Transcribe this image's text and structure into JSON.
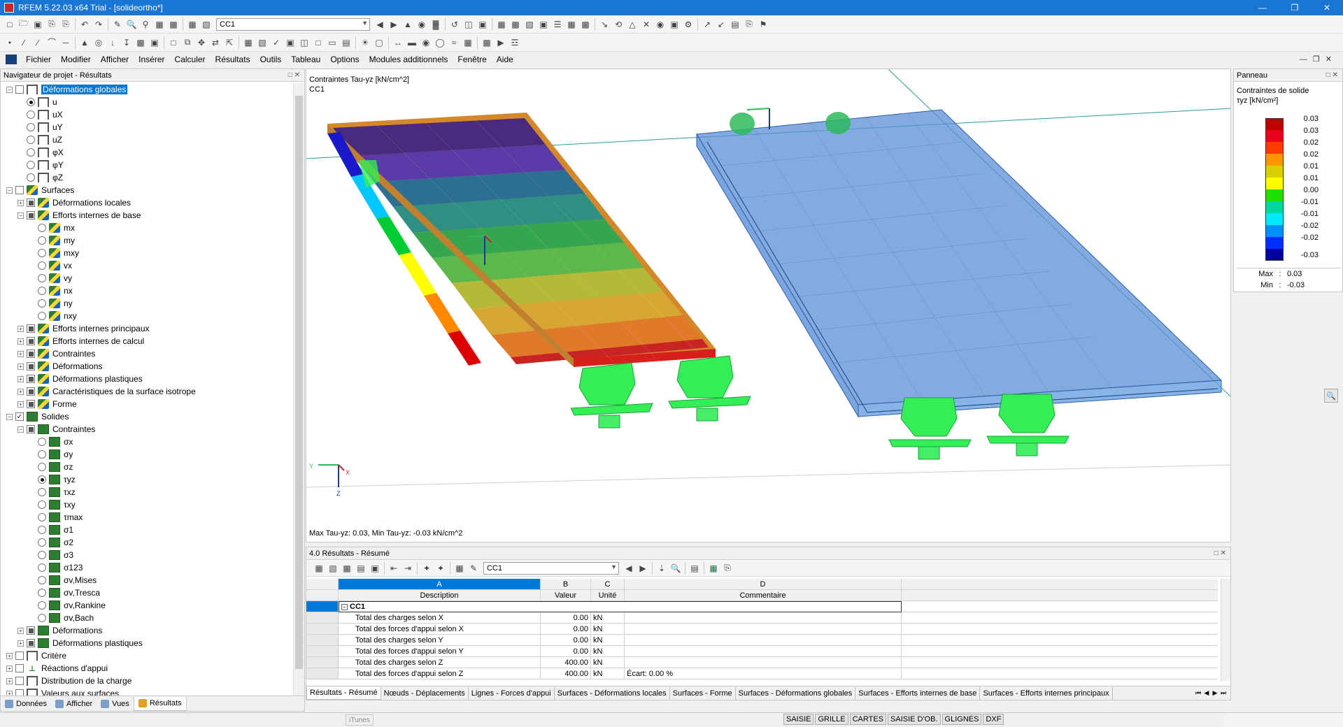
{
  "window": {
    "title": "RFEM 5.22.03 x64 Trial - [solideortho*]"
  },
  "toolbar": {
    "load_case": "CC1"
  },
  "menu": [
    "Fichier",
    "Modifier",
    "Afficher",
    "Insérer",
    "Calculer",
    "Résultats",
    "Outils",
    "Tableau",
    "Options",
    "Modules additionnels",
    "Fenêtre",
    "Aide"
  ],
  "navigator": {
    "title": "Navigateur de projet - Résultats",
    "rows": [
      {
        "d": 0,
        "exp": "-",
        "cb": "empty",
        "icon": "frame",
        "label": "Déformations globales",
        "hl": true
      },
      {
        "d": 1,
        "rb": "sel",
        "icon": "frame",
        "label": "u"
      },
      {
        "d": 1,
        "rb": "",
        "icon": "frame",
        "label": "uX"
      },
      {
        "d": 1,
        "rb": "",
        "icon": "frame",
        "label": "uY"
      },
      {
        "d": 1,
        "rb": "",
        "icon": "frame",
        "label": "uZ"
      },
      {
        "d": 1,
        "rb": "",
        "icon": "frame",
        "label": "φX"
      },
      {
        "d": 1,
        "rb": "",
        "icon": "frame",
        "label": "φY"
      },
      {
        "d": 1,
        "rb": "",
        "icon": "frame",
        "label": "φZ"
      },
      {
        "d": 0,
        "exp": "-",
        "cb": "empty",
        "icon": "surf",
        "label": "Surfaces"
      },
      {
        "d": 1,
        "exp": "+",
        "cb": "partial",
        "icon": "surf",
        "label": "Déformations locales"
      },
      {
        "d": 1,
        "exp": "-",
        "cb": "partial",
        "icon": "surf",
        "label": "Efforts internes de base"
      },
      {
        "d": 2,
        "rb": "",
        "icon": "surf",
        "label": "mx"
      },
      {
        "d": 2,
        "rb": "",
        "icon": "surf",
        "label": "my"
      },
      {
        "d": 2,
        "rb": "",
        "icon": "surf",
        "label": "mxy"
      },
      {
        "d": 2,
        "rb": "",
        "icon": "surf",
        "label": "vx"
      },
      {
        "d": 2,
        "rb": "",
        "icon": "surf",
        "label": "vy"
      },
      {
        "d": 2,
        "rb": "",
        "icon": "surf",
        "label": "nx"
      },
      {
        "d": 2,
        "rb": "",
        "icon": "surf",
        "label": "ny"
      },
      {
        "d": 2,
        "rb": "",
        "icon": "surf",
        "label": "nxy"
      },
      {
        "d": 1,
        "exp": "+",
        "cb": "partial",
        "icon": "surf",
        "label": "Efforts internes principaux"
      },
      {
        "d": 1,
        "exp": "+",
        "cb": "partial",
        "icon": "surf",
        "label": "Efforts internes de calcul"
      },
      {
        "d": 1,
        "exp": "+",
        "cb": "partial",
        "icon": "surf",
        "label": "Contraintes"
      },
      {
        "d": 1,
        "exp": "+",
        "cb": "partial",
        "icon": "surf",
        "label": "Déformations"
      },
      {
        "d": 1,
        "exp": "+",
        "cb": "partial",
        "icon": "surf",
        "label": "Déformations plastiques"
      },
      {
        "d": 1,
        "exp": "+",
        "cb": "partial",
        "icon": "surf",
        "label": "Caractéristiques de la surface isotrope"
      },
      {
        "d": 1,
        "exp": "+",
        "cb": "partial",
        "icon": "surf",
        "label": "Forme"
      },
      {
        "d": 0,
        "exp": "-",
        "cb": "checked",
        "icon": "solid",
        "label": "Solides"
      },
      {
        "d": 1,
        "exp": "-",
        "cb": "partial",
        "icon": "solid",
        "label": "Contraintes"
      },
      {
        "d": 2,
        "rb": "",
        "icon": "solid",
        "label": "σx"
      },
      {
        "d": 2,
        "rb": "",
        "icon": "solid",
        "label": "σy"
      },
      {
        "d": 2,
        "rb": "",
        "icon": "solid",
        "label": "σz"
      },
      {
        "d": 2,
        "rb": "sel",
        "icon": "solid",
        "label": "τyz"
      },
      {
        "d": 2,
        "rb": "",
        "icon": "solid",
        "label": "τxz"
      },
      {
        "d": 2,
        "rb": "",
        "icon": "solid",
        "label": "τxy"
      },
      {
        "d": 2,
        "rb": "",
        "icon": "solid",
        "label": "τmax"
      },
      {
        "d": 2,
        "rb": "",
        "icon": "solid",
        "label": "σ1"
      },
      {
        "d": 2,
        "rb": "",
        "icon": "solid",
        "label": "σ2"
      },
      {
        "d": 2,
        "rb": "",
        "icon": "solid",
        "label": "σ3"
      },
      {
        "d": 2,
        "rb": "",
        "icon": "solid",
        "label": "σ123"
      },
      {
        "d": 2,
        "rb": "",
        "icon": "solid",
        "label": "σv,Mises"
      },
      {
        "d": 2,
        "rb": "",
        "icon": "solid",
        "label": "σv,Tresca"
      },
      {
        "d": 2,
        "rb": "",
        "icon": "solid",
        "label": "σv,Rankine"
      },
      {
        "d": 2,
        "rb": "",
        "icon": "solid",
        "label": "σv,Bach"
      },
      {
        "d": 1,
        "exp": "+",
        "cb": "partial",
        "icon": "solid",
        "label": "Déformations"
      },
      {
        "d": 1,
        "exp": "+",
        "cb": "partial",
        "icon": "solid",
        "label": "Déformations plastiques"
      },
      {
        "d": 0,
        "exp": "+",
        "cb": "empty",
        "icon": "frame",
        "label": "Critère"
      },
      {
        "d": 0,
        "exp": "+",
        "cb": "empty",
        "icon": "supp",
        "label": "Réactions d'appui"
      },
      {
        "d": 0,
        "exp": "+",
        "cb": "empty",
        "icon": "frame",
        "label": "Distribution de la charge"
      },
      {
        "d": 0,
        "exp": "+",
        "cb": "empty",
        "icon": "frame",
        "label": "Valeurs aux surfaces"
      }
    ],
    "tabs": [
      {
        "label": "Données",
        "active": false
      },
      {
        "label": "Afficher",
        "active": false
      },
      {
        "label": "Vues",
        "active": false
      },
      {
        "label": "Résultats",
        "active": true
      }
    ]
  },
  "viewport": {
    "title_line1": "Contraintes Tau-yz [kN/cm^2]",
    "title_line2": "CC1",
    "footer": "Max Tau-yz: 0.03, Min Tau-yz: -0.03 kN/cm^2",
    "axis_labels": {
      "y": "Y",
      "x": "X",
      "z": "Z"
    }
  },
  "panel": {
    "title": "Panneau",
    "heading": "Contraintes de solide",
    "unit": "τyz [kN/cm²]",
    "legend_values": [
      "0.03",
      "0.03",
      "0.02",
      "0.02",
      "0.01",
      "0.01",
      "0.00",
      "-0.01",
      "-0.01",
      "-0.02",
      "-0.02",
      "-0.03"
    ],
    "legend_colors": [
      "#c00000",
      "#e8001c",
      "#ff3c00",
      "#ff9600",
      "#d8d000",
      "#ffff00",
      "#20e000",
      "#00d8a0",
      "#00e8ff",
      "#0090ff",
      "#0030ff",
      "#0000a0"
    ],
    "max_label": "Max",
    "max_value": "0.03",
    "min_label": "Min",
    "min_value": "-0.03"
  },
  "results": {
    "title": "4.0 Résultats - Résumé",
    "load_case": "CC1",
    "col_letters": [
      "A",
      "B",
      "C",
      "D"
    ],
    "col_names": [
      "Description",
      "Valeur",
      "Unité",
      "Commentaire"
    ],
    "group": "CC1",
    "rows": [
      {
        "desc": "Total des charges selon X",
        "val": "0.00",
        "unit": "kN",
        "comment": ""
      },
      {
        "desc": "Total des forces d'appui selon X",
        "val": "0.00",
        "unit": "kN",
        "comment": ""
      },
      {
        "desc": "Total des charges selon Y",
        "val": "0.00",
        "unit": "kN",
        "comment": ""
      },
      {
        "desc": "Total des forces d'appui selon Y",
        "val": "0.00",
        "unit": "kN",
        "comment": ""
      },
      {
        "desc": "Total des charges selon Z",
        "val": "400.00",
        "unit": "kN",
        "comment": ""
      },
      {
        "desc": "Total des forces d'appui selon Z",
        "val": "400.00",
        "unit": "kN",
        "comment": "Écart:  0.00 %"
      }
    ],
    "tabs": [
      "Résultats - Résumé",
      "Nœuds - Déplacements",
      "Lignes - Forces d'appui",
      "Surfaces - Déformations locales",
      "Surfaces - Forme",
      "Surfaces - Déformations globales",
      "Surfaces - Efforts internes de base",
      "Surfaces - Efforts internes principaux"
    ]
  },
  "statusbar": {
    "itunes": "iTunes",
    "buttons": [
      "SAISIE",
      "GRILLE",
      "CARTES",
      "SAISIE D'OB.",
      "GLIGNES",
      "DXF"
    ]
  }
}
